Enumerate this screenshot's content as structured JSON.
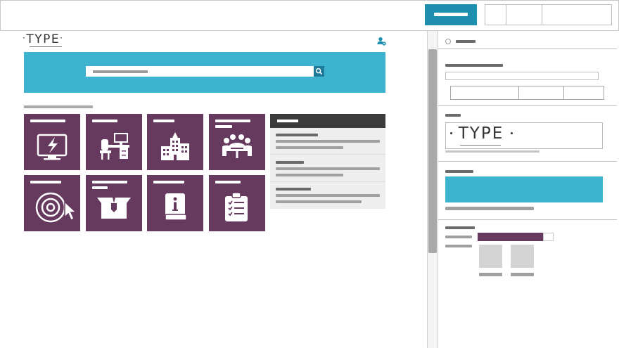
{
  "toolbar": {
    "primary_button": {
      "label_icon": "label-placeholder-bar",
      "color": "#1f8fb0"
    },
    "segments": [
      "",
      "",
      ""
    ]
  },
  "canvas": {
    "logo": {
      "text": "TYPE"
    },
    "user_icon": "user-settings-icon",
    "hero": {
      "color": "#3db3cf"
    },
    "search": {
      "placeholder": "",
      "icon": "search-icon"
    },
    "tiles": [
      {
        "icon": "monitor-lightning-icon",
        "color": "#663a5f"
      },
      {
        "icon": "office-desk-icon",
        "color": "#663a5f"
      },
      {
        "icon": "buildings-icon",
        "color": "#663a5f"
      },
      {
        "icon": "meeting-people-icon",
        "color": "#663a5f"
      },
      {
        "icon": "disc-cursor-icon",
        "color": "#663a5f"
      },
      {
        "icon": "open-box-icon",
        "color": "#663a5f"
      },
      {
        "icon": "info-book-icon",
        "color": "#663a5f"
      },
      {
        "icon": "clipboard-checklist-icon",
        "color": "#663a5f"
      }
    ],
    "news": {
      "items": 3
    }
  },
  "panel": {
    "logo_preview": {
      "text": "TYPE"
    },
    "brand_color": "#3db3cf",
    "accent_color": "#663a5f"
  }
}
